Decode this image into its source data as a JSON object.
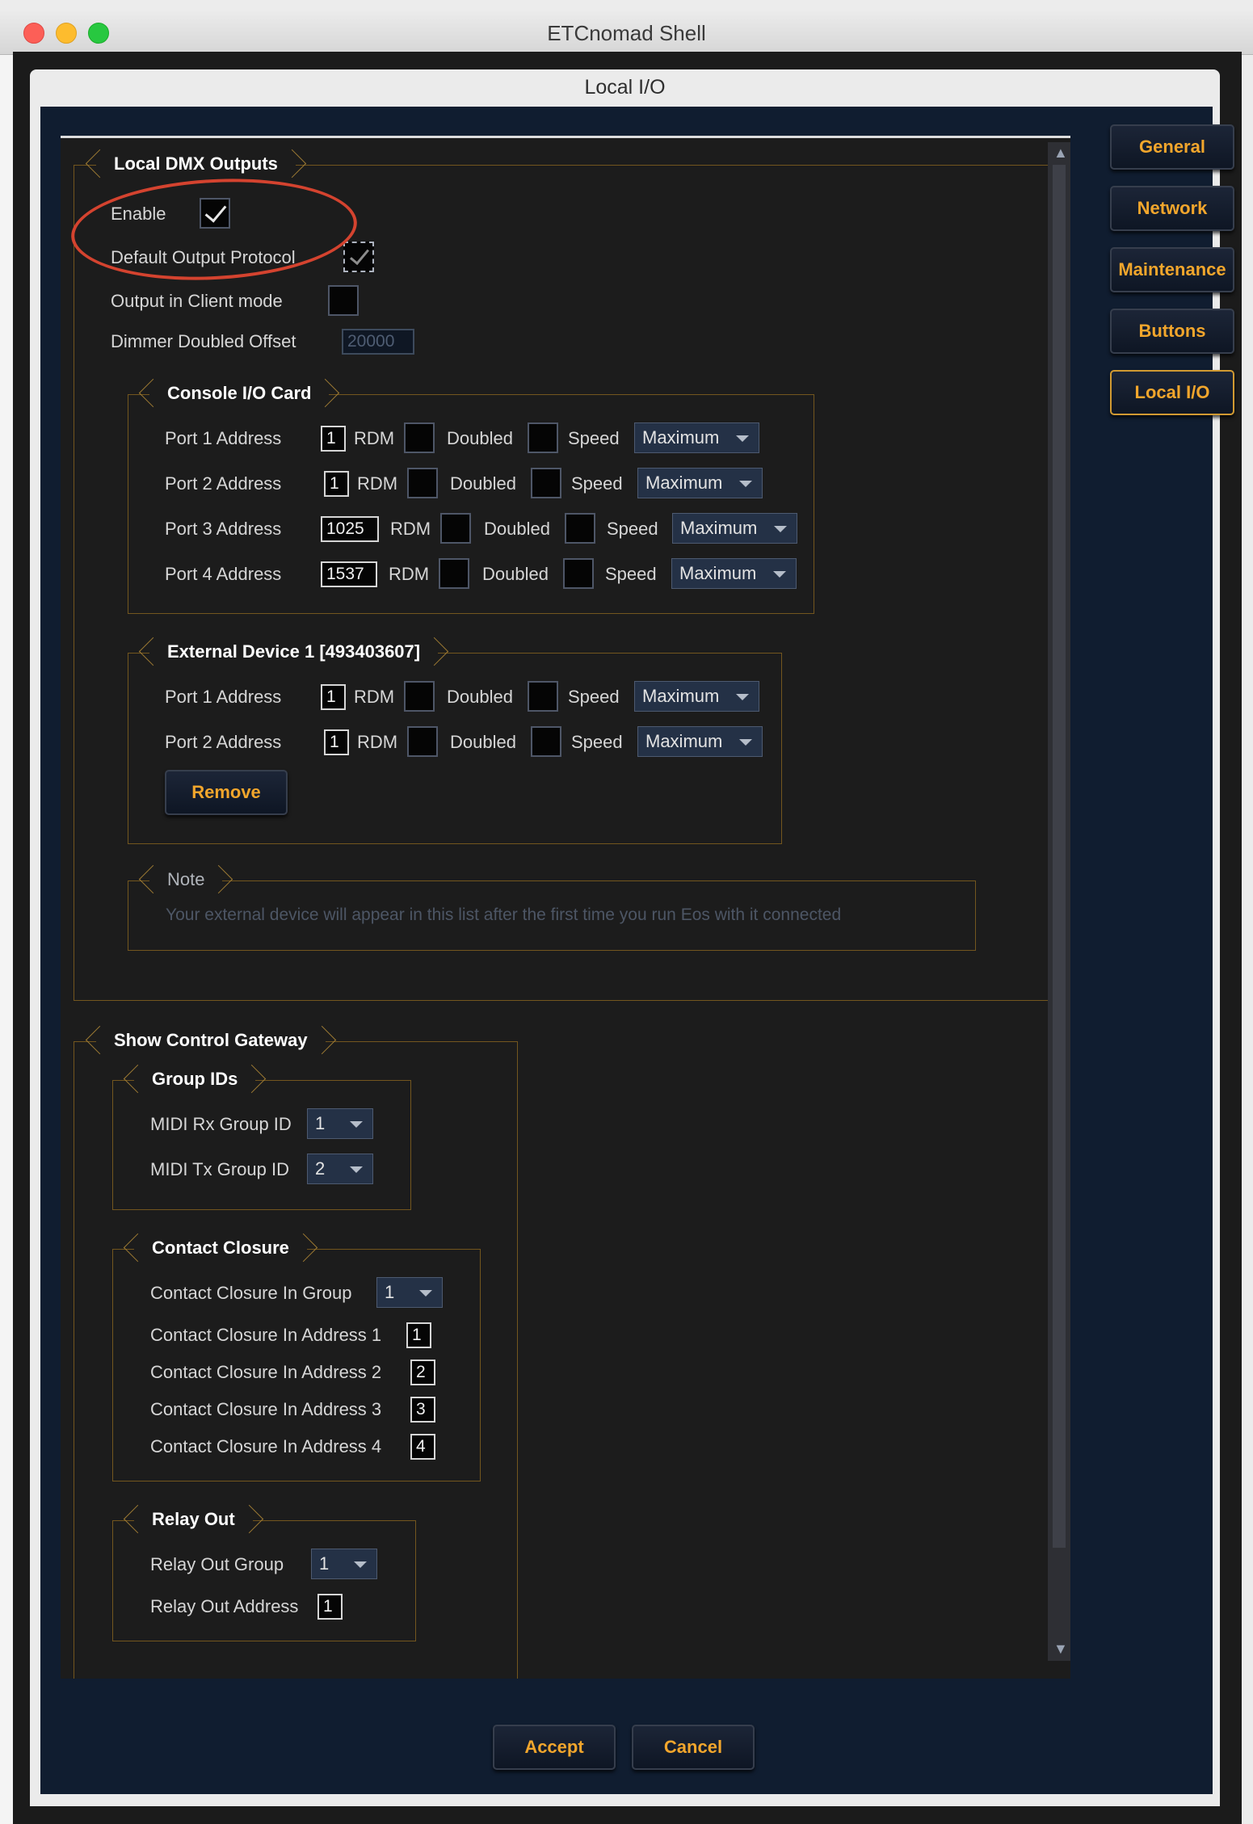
{
  "window": {
    "title": "ETCnomad Shell"
  },
  "dialog": {
    "title": "Local I/O"
  },
  "local_dmx": {
    "title": "Local DMX Outputs",
    "enable_label": "Enable",
    "enable_checked": true,
    "default_protocol_label": "Default Output Protocol",
    "client_mode_label": "Output in Client mode",
    "dimmer_offset_label": "Dimmer Doubled Offset",
    "dimmer_offset_value": "20000"
  },
  "console_card": {
    "title": "Console I/O Card",
    "ports": [
      {
        "label": "Port 1 Address",
        "address": "1",
        "rdm": "RDM",
        "doubled": "Doubled",
        "speed": "Speed",
        "speed_value": "Maximum"
      },
      {
        "label": "Port 2 Address",
        "address": "1",
        "rdm": "RDM",
        "doubled": "Doubled",
        "speed": "Speed",
        "speed_value": "Maximum"
      },
      {
        "label": "Port 3 Address",
        "address": "1025",
        "rdm": "RDM",
        "doubled": "Doubled",
        "speed": "Speed",
        "speed_value": "Maximum"
      },
      {
        "label": "Port 4 Address",
        "address": "1537",
        "rdm": "RDM",
        "doubled": "Doubled",
        "speed": "Speed",
        "speed_value": "Maximum"
      }
    ]
  },
  "external_device": {
    "title": "External Device 1  [493403607]",
    "ports": [
      {
        "label": "Port 1 Address",
        "address": "1",
        "rdm": "RDM",
        "doubled": "Doubled",
        "speed": "Speed",
        "speed_value": "Maximum"
      },
      {
        "label": "Port 2 Address",
        "address": "1",
        "rdm": "RDM",
        "doubled": "Doubled",
        "speed": "Speed",
        "speed_value": "Maximum"
      }
    ],
    "remove_label": "Remove"
  },
  "note": {
    "title": "Note",
    "text": "Your external device will appear in this list after the first time you run Eos with it connected"
  },
  "show_control": {
    "title": "Show Control Gateway",
    "group_ids": {
      "title": "Group IDs",
      "rx_label": "MIDI Rx Group ID",
      "rx_value": "1",
      "tx_label": "MIDI Tx Group ID",
      "tx_value": "2"
    },
    "contact_closure": {
      "title": "Contact Closure",
      "in_group_label": "Contact Closure In Group",
      "in_group_value": "1",
      "addresses": [
        {
          "label": "Contact Closure In Address 1",
          "value": "1"
        },
        {
          "label": "Contact Closure In Address 2",
          "value": "2"
        },
        {
          "label": "Contact Closure In Address 3",
          "value": "3"
        },
        {
          "label": "Contact Closure In Address 4",
          "value": "4"
        }
      ]
    },
    "relay_out": {
      "title": "Relay Out",
      "group_label": "Relay Out Group",
      "group_value": "1",
      "address_label": "Relay Out Address",
      "address_value": "1"
    }
  },
  "sidebar": {
    "items": [
      {
        "label": "General"
      },
      {
        "label": "Network"
      },
      {
        "label": "Maintenance"
      },
      {
        "label": "Buttons"
      },
      {
        "label": "Local I/O"
      }
    ],
    "active": "Local I/O"
  },
  "footer": {
    "accept_label": "Accept",
    "cancel_label": "Cancel"
  },
  "colors": {
    "accent": "#f2a62c",
    "annotation": "#d4432f",
    "panel_bg": "#1c1c1c",
    "frame_bg": "#101d30"
  }
}
